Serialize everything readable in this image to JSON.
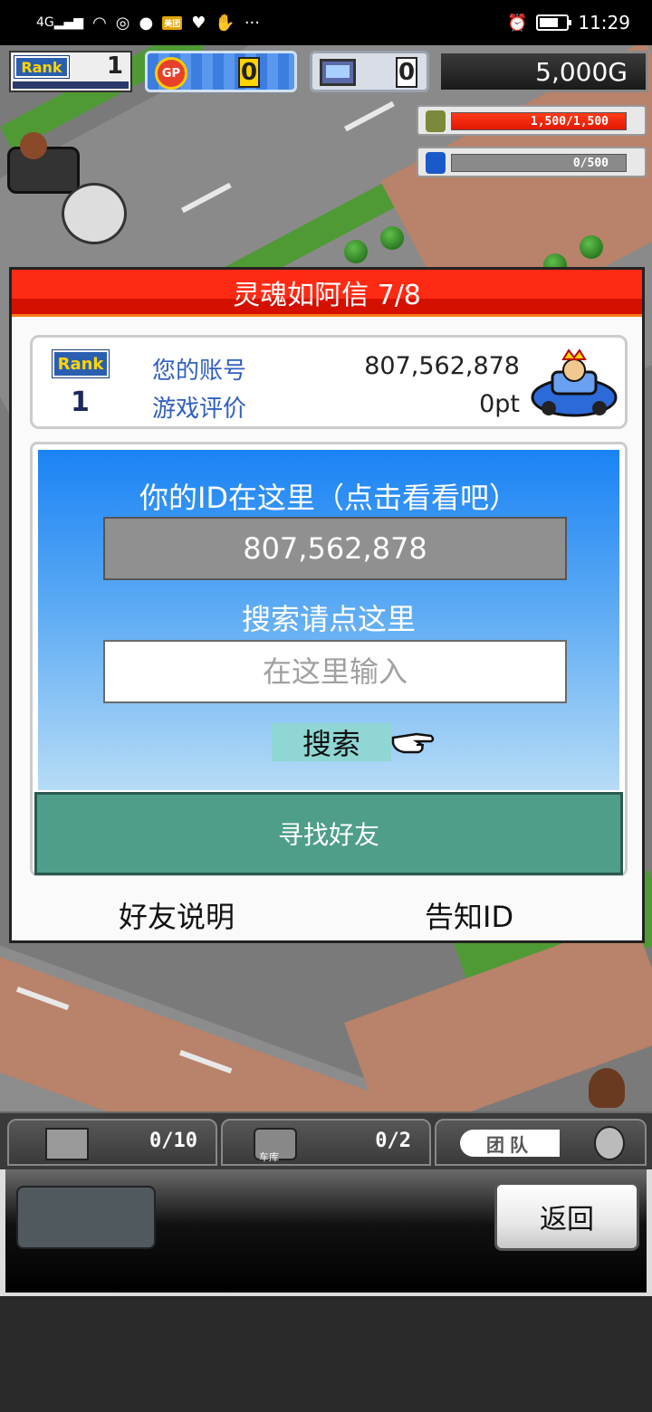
{
  "status_bar": {
    "network": "4G",
    "time": "11:29",
    "badge": "美团"
  },
  "hud": {
    "rank_label": "Rank",
    "rank_value": "1",
    "gp_label": "GP",
    "gp_value": "0",
    "pc_value": "0",
    "gold": "5,000G",
    "meters": [
      {
        "text": "1,500/1,500",
        "fill": 1.0,
        "color": "#e41800"
      },
      {
        "text": "0/500",
        "fill": 0.0,
        "color": "#e41800"
      }
    ]
  },
  "dialog": {
    "title": "灵魂如阿信 7/8",
    "account": {
      "rank_label": "Rank",
      "rank_value": "1",
      "id_label": "您的账号",
      "id_value": "807,562,878",
      "rating_label": "游戏评价",
      "rating_value": "0pt"
    },
    "id_section": {
      "title": "你的ID在这里（点击看看吧）",
      "id_value": "807,562,878"
    },
    "search_section": {
      "title": "搜索请点这里",
      "placeholder": "在这里输入",
      "button": "搜索"
    },
    "find_friend_button": "寻找好友",
    "links": {
      "friend_help": "好友说明",
      "share_id": "告知ID"
    }
  },
  "bottom_tabs": [
    {
      "count": "0/10"
    },
    {
      "count": "0/2",
      "sublabel": "车库"
    },
    {
      "label": "团队"
    }
  ],
  "bottom_panel": {
    "back_button": "返回"
  }
}
